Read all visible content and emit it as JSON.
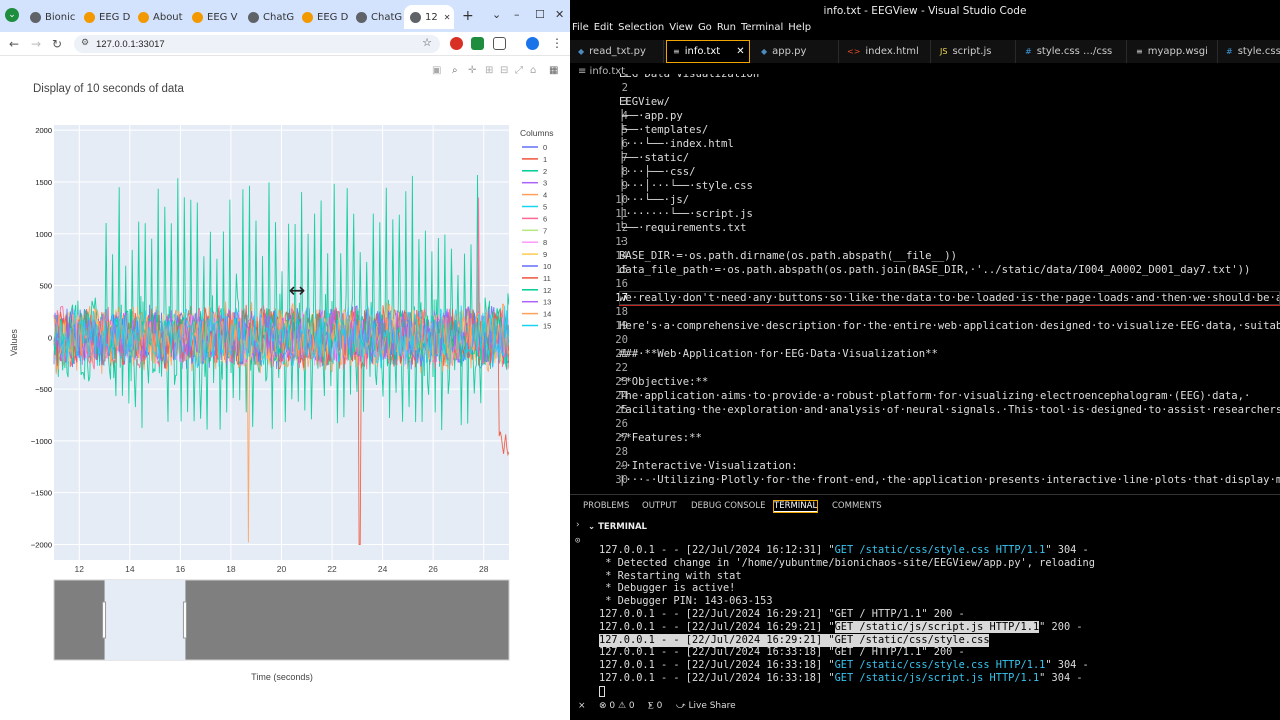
{
  "browser": {
    "tabs": [
      {
        "label": "Bionic",
        "color": "#5f6368"
      },
      {
        "label": "EEG D",
        "color": "#f29900"
      },
      {
        "label": "About",
        "color": "#f29900"
      },
      {
        "label": "EEG V",
        "color": "#f29900"
      },
      {
        "label": "ChatG",
        "color": "#5f6368"
      },
      {
        "label": "EEG D",
        "color": "#f29900"
      },
      {
        "label": "ChatG",
        "color": "#5f6368"
      },
      {
        "label": "12",
        "color": "#5f6368"
      }
    ],
    "url": "127.0.0.1:33017",
    "new_tab": "+",
    "window_controls": [
      "⌄",
      "–",
      "☐",
      "✕"
    ]
  },
  "plot": {
    "title": "Display of 10 seconds of data",
    "xlabel": "Time (seconds)",
    "ylabel": "Values",
    "legend_title": "Columns"
  },
  "chart_data": {
    "type": "line",
    "title": "Display of 10 seconds of data",
    "xlabel": "Time (seconds)",
    "ylabel": "Values",
    "xlim": [
      11,
      29
    ],
    "ylim": [
      -2150,
      2050
    ],
    "x_ticks": [
      12,
      14,
      16,
      18,
      20,
      22,
      24,
      26,
      28
    ],
    "y_ticks": [
      2000,
      1500,
      1000,
      500,
      0,
      -500,
      -1000,
      -1500,
      -2000
    ],
    "y_tick_labels": [
      "2000",
      "1500",
      "1000",
      "500",
      "0",
      "−500",
      "−1000",
      "−1500",
      "−2000"
    ],
    "legend": "top-right",
    "grid": true,
    "range_slider": {
      "selected": [
        13,
        16.2
      ]
    },
    "series": [
      {
        "name": "0",
        "color": "#636efa"
      },
      {
        "name": "1",
        "color": "#ef553b"
      },
      {
        "name": "2",
        "color": "#00cc96"
      },
      {
        "name": "3",
        "color": "#ab63fa"
      },
      {
        "name": "4",
        "color": "#ffa15a"
      },
      {
        "name": "5",
        "color": "#19d3f3"
      },
      {
        "name": "6",
        "color": "#ff6692"
      },
      {
        "name": "7",
        "color": "#b6e880"
      },
      {
        "name": "8",
        "color": "#ff97ff"
      },
      {
        "name": "9",
        "color": "#fecb52"
      },
      {
        "name": "10",
        "color": "#636efa"
      },
      {
        "name": "11",
        "color": "#ef553b"
      },
      {
        "name": "12",
        "color": "#00cc96"
      },
      {
        "name": "13",
        "color": "#ab63fa"
      },
      {
        "name": "14",
        "color": "#ffa15a"
      },
      {
        "name": "15",
        "color": "#19d3f3"
      }
    ]
  },
  "vscode": {
    "title": "info.txt - EEGView - Visual Studio Code",
    "menu": [
      "File",
      "Edit",
      "Selection",
      "View",
      "Go",
      "Run",
      "Terminal",
      "Help"
    ],
    "tabs": [
      {
        "label": "read_txt.py",
        "icon": "◆",
        "icon_color": "#4b8bbe"
      },
      {
        "label": "info.txt",
        "icon": "≡",
        "icon_color": "#ccc",
        "close": "✕"
      },
      {
        "label": "app.py",
        "icon": "◆",
        "icon_color": "#4b8bbe"
      },
      {
        "label": "index.html",
        "icon": "<>",
        "icon_color": "#e44d26"
      },
      {
        "label": "script.js",
        "icon": "JS",
        "icon_color": "#f0db4f"
      },
      {
        "label": "style.css …/css",
        "icon": "#",
        "icon_color": "#3c99dc"
      },
      {
        "label": "myapp.wsgi",
        "icon": "≡",
        "icon_color": "#ccc"
      },
      {
        "label": "style.css",
        "icon": "#",
        "icon_color": "#3c99dc"
      }
    ],
    "breadcrumb": "≡ info.txt",
    "lines": [
      {
        "n": "1",
        "t": "EEG·Data·Visualization"
      },
      {
        "n": "2",
        "t": ""
      },
      {
        "n": "3",
        "t": "EEGView/"
      },
      {
        "n": "4",
        "t": "├──·app.py"
      },
      {
        "n": "5",
        "t": "├──·templates/"
      },
      {
        "n": "6",
        "t": "│···└──·index.html"
      },
      {
        "n": "7",
        "t": "├──·static/"
      },
      {
        "n": "8",
        "t": "│···├──·css/"
      },
      {
        "n": "9",
        "t": "│···│···└──·style.css"
      },
      {
        "n": "10",
        "t": "│···└──·js/"
      },
      {
        "n": "11",
        "t": "│·······└──·script.js"
      },
      {
        "n": "12",
        "t": "└──·requirements.txt"
      },
      {
        "n": "13",
        "t": "·"
      },
      {
        "n": "14",
        "t": "BASE_DIR·=·os.path.dirname(os.path.abspath(__file__))"
      },
      {
        "n": "15",
        "t": "data_file_path·=·os.path.abspath(os.path.join(BASE_DIR,·'../static/data/I004_A0002_D001_day7.txt'))"
      },
      {
        "n": "16",
        "t": ""
      },
      {
        "n": "17",
        "t": "we·really·don't·need·any·buttons·so·like·the·data·to·be·loaded·is·the·page·loads·and·then·we·should·be·able"
      },
      {
        "n": "18",
        "t": ""
      },
      {
        "n": "19",
        "t": "Here's·a·comprehensive·description·for·the·entire·web·application·designed·to·visualize·EEG·data,·suitable"
      },
      {
        "n": "20",
        "t": ""
      },
      {
        "n": "21",
        "t": "###·**Web·Application·for·EEG·Data·Visualization**"
      },
      {
        "n": "22",
        "t": ""
      },
      {
        "n": "23",
        "t": "**Objective:**"
      },
      {
        "n": "24",
        "t": "The·application·aims·to·provide·a·robust·platform·for·visualizing·electroencephalogram·(EEG)·data,·"
      },
      {
        "n": "25",
        "t": "facilitating·the·exploration·and·analysis·of·neural·signals.·This·tool·is·designed·to·assist·researchers,·"
      },
      {
        "n": "26",
        "t": ""
      },
      {
        "n": "27",
        "t": "**Features:**"
      },
      {
        "n": "28",
        "t": ""
      },
      {
        "n": "29",
        "t": "-·Interactive·Visualization:"
      },
      {
        "n": "30",
        "t": "|···-·Utilizing·Plotly·for·the·front-end,·the·application·presents·interactive·line·plots·that·display·mult"
      }
    ],
    "panel_tabs": [
      "PROBLEMS",
      "OUTPUT",
      "DEBUG CONSOLE",
      "TERMINAL",
      "COMMENTS"
    ],
    "terminal_title": "TERMINAL",
    "terminal": [
      {
        "pre": "127.0.0.1 - - [22/Jul/2024 16:12:31] \"",
        "req": "GET /static/css/style.css HTTP/1.1",
        "post": "\" 304 -"
      },
      {
        "pre": " * Detected change in '/home/yubuntme/bionichaos-site/EEGView/app.py', reloading",
        "req": "",
        "post": ""
      },
      {
        "pre": " * Restarting with stat",
        "req": "",
        "post": ""
      },
      {
        "pre": " * Debugger is active!",
        "req": "",
        "post": ""
      },
      {
        "pre": " * Debugger PIN: 143-063-153",
        "req": "",
        "post": ""
      },
      {
        "pre": "127.0.0.1 - - [22/Jul/2024 16:29:21] \"GET / HTTP/1.1\" 200 -",
        "req": "",
        "post": ""
      },
      {
        "pre": "127.0.0.1 - - [22/Jul/2024 16:29:21] \"",
        "req": "GET /static/js/script.js HTTP/1.1",
        "post": "\" 200 -"
      },
      {
        "pre": "127.0.0.1 - - [22/Jul/2024 16:29:21] \"",
        "req": "GET /static/css/style.css HTTP/1.1",
        "post": "\" 200 -"
      },
      {
        "pre": "127.0.0.1 - - [22/Jul/2024 16:33:18] \"GET / HTTP/1.1\" 200 -",
        "req": "",
        "post": ""
      },
      {
        "pre": "127.0.0.1 - - [22/Jul/2024 16:33:18] \"",
        "req": "GET /static/css/style.css HTTP/1.1",
        "post": "\" 304 -"
      },
      {
        "pre": "127.0.0.1 - - [22/Jul/2024 16:33:18] \"",
        "req": "GET /static/js/script.js HTTP/1.1",
        "post": "\" 304 -"
      }
    ],
    "status": {
      "remote": "⨯",
      "problems": "⊗ 0 ⚠ 0",
      "ports": "⨊ 0",
      "live_share": "⤻ Live Share"
    }
  }
}
